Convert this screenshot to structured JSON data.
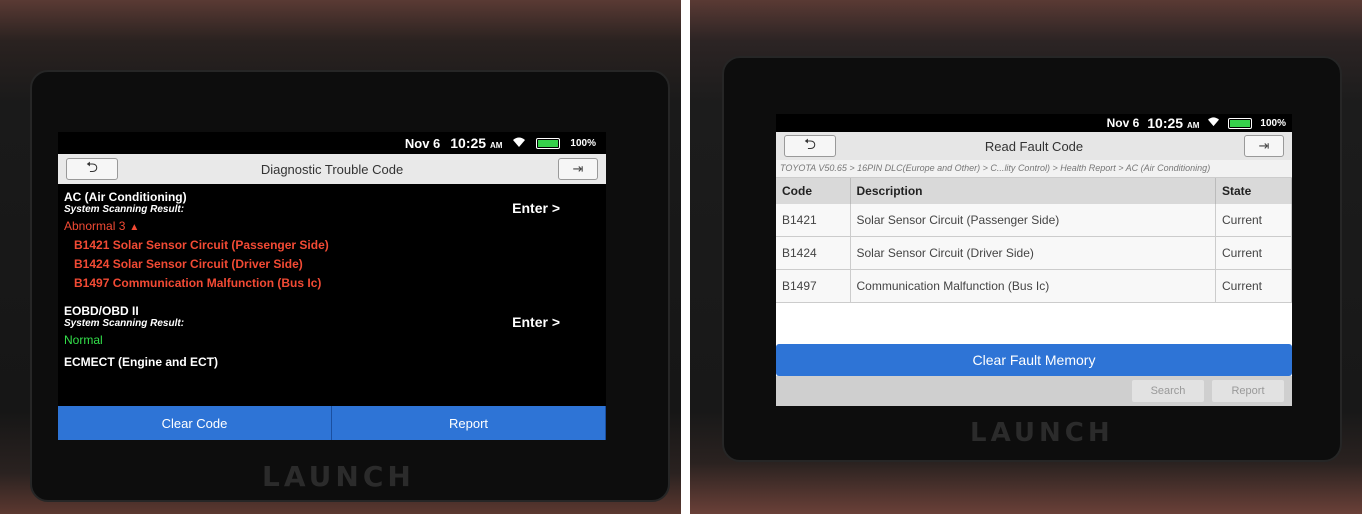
{
  "left": {
    "status": {
      "date": "Nov 6",
      "time": "10:25",
      "ampm": "AM",
      "battery": "100%"
    },
    "title": "Diagnostic Trouble Code",
    "systems": [
      {
        "name": "AC (Air Conditioning)",
        "scan_label": "System Scanning Result:",
        "result": "Abnormal 3",
        "enter": "Enter >",
        "faults": [
          "B1421 Solar Sensor Circuit (Passenger Side)",
          "B1424 Solar Sensor Circuit (Driver Side)",
          "B1497 Communication Malfunction (Bus Ic)"
        ]
      },
      {
        "name": "EOBD/OBD II",
        "scan_label": "System Scanning Result:",
        "result": "Normal",
        "enter": "Enter >"
      }
    ],
    "partial_system": "ECMECT (Engine and ECT)",
    "buttons": {
      "clear": "Clear Code",
      "report": "Report"
    },
    "brand": "LAUNCH"
  },
  "right": {
    "status": {
      "date": "Nov 6",
      "time": "10:25",
      "ampm": "AM",
      "battery": "100%"
    },
    "title": "Read Fault Code",
    "breadcrumb": "TOYOTA V50.65 > 16PIN DLC(Europe and Other) > C...lity Control) > Health Report > AC (Air Conditioning)",
    "columns": {
      "code": "Code",
      "description": "Description",
      "state": "State"
    },
    "rows": [
      {
        "code": "B1421",
        "description": "Solar Sensor Circuit (Passenger Side)",
        "state": "Current"
      },
      {
        "code": "B1424",
        "description": "Solar Sensor Circuit (Driver Side)",
        "state": "Current"
      },
      {
        "code": "B1497",
        "description": "Communication Malfunction (Bus Ic)",
        "state": "Current"
      }
    ],
    "clear_memory": "Clear Fault Memory",
    "search": "Search",
    "report": "Report",
    "brand": "LAUNCH"
  },
  "colors": {
    "accent": "#2e74d6",
    "fault": "#f24a34",
    "normal": "#33e04a",
    "battery": "#36d14b"
  }
}
